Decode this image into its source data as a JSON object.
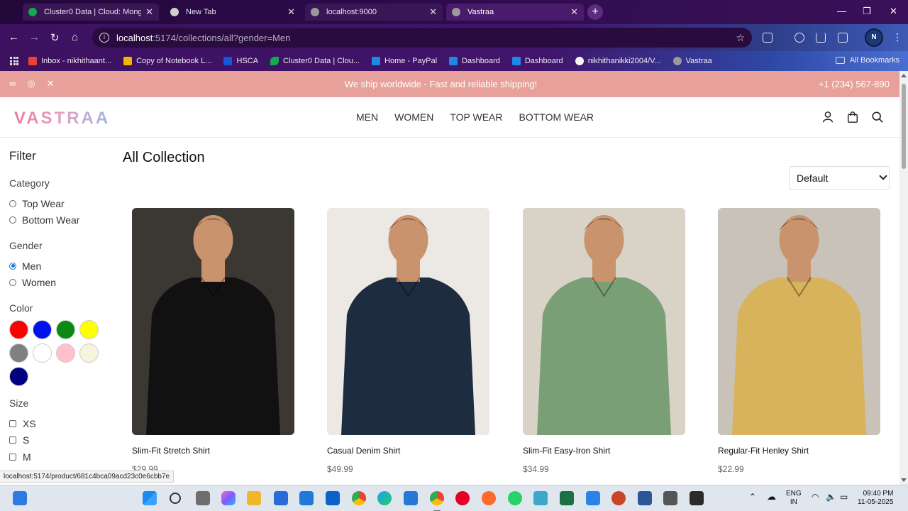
{
  "browser": {
    "tabs": [
      {
        "title": "Cluster0 Data | Cloud: MongoDB",
        "favicon_color": "#13aa52",
        "active": false
      },
      {
        "title": "New Tab",
        "favicon_color": "#cfcfcf",
        "active": false
      },
      {
        "title": "localhost:9000",
        "favicon_color": "#9a9a9a",
        "active": false
      },
      {
        "title": "Vastraa",
        "favicon_color": "#9a9a9a",
        "active": true
      }
    ],
    "url_host": "localhost",
    "url_rest": ":5174/collections/all?gender=Men",
    "profile_initial": "N",
    "bookmarks": [
      {
        "label": "Inbox - nikhithaant...",
        "color": "#ea4335"
      },
      {
        "label": "Copy of Notebook L...",
        "color": "#f4b400"
      },
      {
        "label": "HSCA",
        "color": "#1a56db"
      },
      {
        "label": "Cluster0 Data | Clou...",
        "color": "#13aa52"
      },
      {
        "label": "Home - PayPal",
        "color": "#1e88e5"
      },
      {
        "label": "Dashboard",
        "color": "#1e88e5"
      },
      {
        "label": "Dashboard",
        "color": "#1e88e5"
      },
      {
        "label": "nikhithanikki2004/V...",
        "color": "#f5f5f5"
      },
      {
        "label": "Vastraa",
        "color": "#9a9a9a"
      }
    ],
    "all_bookmarks": "All Bookmarks",
    "status_url": "localhost:5174/product/681c4bca09acd23c0e6cbb7e"
  },
  "announcement": {
    "message": "We ship worldwide - Fast and reliable shipping!",
    "phone": "+1 (234) 567-890",
    "social": [
      "meta-icon",
      "instagram-icon",
      "x-icon"
    ]
  },
  "header": {
    "logo": "VASTRAA",
    "nav": [
      "MEN",
      "WOMEN",
      "TOP WEAR",
      "BOTTOM WEAR"
    ]
  },
  "filter": {
    "title": "Filter",
    "category_label": "Category",
    "categories": [
      "Top Wear",
      "Bottom Wear"
    ],
    "gender_label": "Gender",
    "genders": [
      "Men",
      "Women"
    ],
    "selected_gender": "Men",
    "color_label": "Color",
    "colors": [
      "#ff0000",
      "#0011ee",
      "#0a8a10",
      "#ffff00",
      "#808080",
      "#ffffff",
      "#ffc0cb",
      "#f5f5dc",
      "#000080"
    ],
    "size_label": "Size",
    "sizes": [
      "XS",
      "S",
      "M"
    ]
  },
  "collection": {
    "title": "All Collection",
    "sort_value": "Default",
    "products": [
      {
        "name": "Slim-Fit Stretch Shirt",
        "price": "$29.99",
        "shirt_color": "#111111",
        "bg_color": "#3b3732"
      },
      {
        "name": "Casual Denim Shirt",
        "price": "$49.99",
        "shirt_color": "#1e2c40",
        "bg_color": "#ece8e4"
      },
      {
        "name": "Slim-Fit Easy-Iron Shirt",
        "price": "$34.99",
        "shirt_color": "#7a9f76",
        "bg_color": "#d9d2c6"
      },
      {
        "name": "Regular-Fit Henley Shirt",
        "price": "$22.99",
        "shirt_color": "#d9b25c",
        "bg_color": "#c8c2b8"
      }
    ]
  },
  "taskbar": {
    "lang_top": "ENG",
    "lang_bottom": "IN",
    "time": "09:40 PM",
    "date": "11-05-2025"
  }
}
